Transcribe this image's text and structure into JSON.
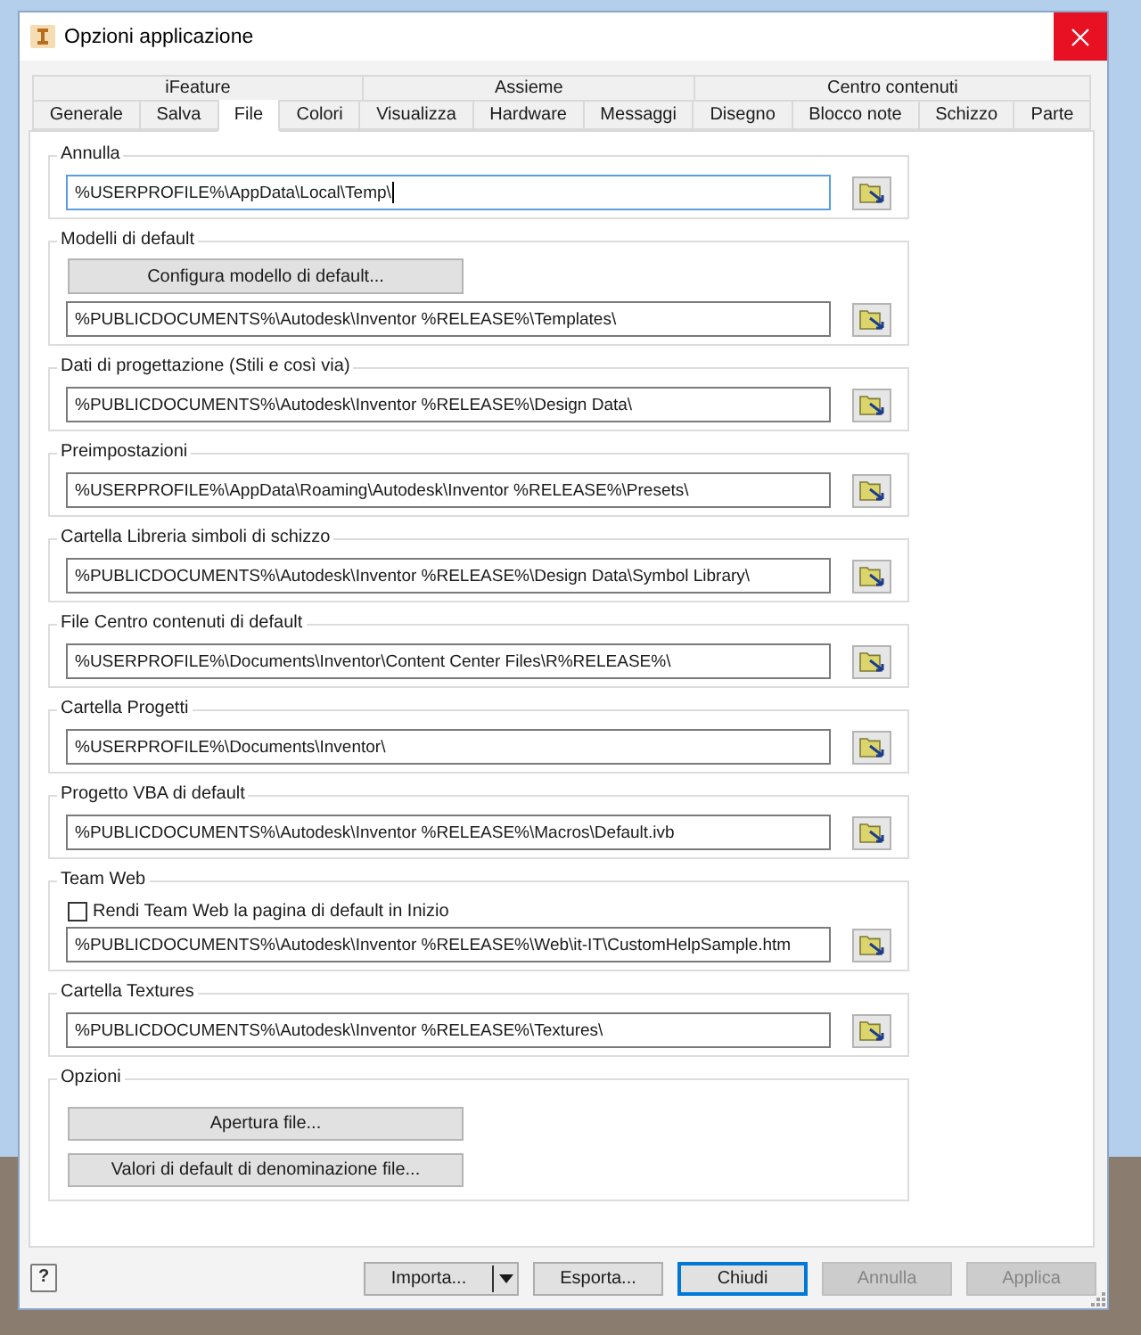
{
  "window": {
    "title": "Opzioni applicazione"
  },
  "tab_rows": [
    [
      {
        "label": "iFeature",
        "selected": false
      },
      {
        "label": "Assieme",
        "selected": false
      },
      {
        "label": "Centro contenuti",
        "selected": false
      }
    ],
    [
      {
        "label": "Generale",
        "selected": false
      },
      {
        "label": "Salva",
        "selected": false
      },
      {
        "label": "File",
        "selected": true
      },
      {
        "label": "Colori",
        "selected": false
      },
      {
        "label": "Visualizza",
        "selected": false
      },
      {
        "label": "Hardware",
        "selected": false
      },
      {
        "label": "Messaggi",
        "selected": false
      },
      {
        "label": "Disegno",
        "selected": false
      },
      {
        "label": "Blocco note",
        "selected": false
      },
      {
        "label": "Schizzo",
        "selected": false
      },
      {
        "label": "Parte",
        "selected": false
      }
    ]
  ],
  "sections": [
    {
      "legend": "Annulla",
      "items": [
        {
          "kind": "path",
          "value": "%USERPROFILE%\\AppData\\Local\\Temp\\",
          "focused": true
        }
      ]
    },
    {
      "legend": "Modelli di default",
      "items": [
        {
          "kind": "button",
          "label": "Configura modello di default..."
        },
        {
          "kind": "path",
          "value": "%PUBLICDOCUMENTS%\\Autodesk\\Inventor %RELEASE%\\Templates\\",
          "focused": false
        }
      ]
    },
    {
      "legend": "Dati di progettazione (Stili e così via)",
      "items": [
        {
          "kind": "path",
          "value": "%PUBLICDOCUMENTS%\\Autodesk\\Inventor %RELEASE%\\Design Data\\",
          "focused": false
        }
      ]
    },
    {
      "legend": "Preimpostazioni",
      "items": [
        {
          "kind": "path",
          "value": "%USERPROFILE%\\AppData\\Roaming\\Autodesk\\Inventor %RELEASE%\\Presets\\",
          "focused": false
        }
      ]
    },
    {
      "legend": "Cartella Libreria simboli di schizzo",
      "items": [
        {
          "kind": "path",
          "value": "%PUBLICDOCUMENTS%\\Autodesk\\Inventor %RELEASE%\\Design Data\\Symbol Library\\",
          "focused": false
        }
      ]
    },
    {
      "legend": "File Centro contenuti di default",
      "items": [
        {
          "kind": "path",
          "value": "%USERPROFILE%\\Documents\\Inventor\\Content Center Files\\R%RELEASE%\\",
          "focused": false
        }
      ]
    },
    {
      "legend": "Cartella Progetti",
      "items": [
        {
          "kind": "path",
          "value": "%USERPROFILE%\\Documents\\Inventor\\",
          "focused": false
        }
      ]
    },
    {
      "legend": "Progetto VBA di default",
      "items": [
        {
          "kind": "path",
          "value": "%PUBLICDOCUMENTS%\\Autodesk\\Inventor %RELEASE%\\Macros\\Default.ivb",
          "focused": false
        }
      ]
    },
    {
      "legend": "Team Web",
      "items": [
        {
          "kind": "checkbox",
          "label": "Rendi Team Web la pagina di default in Inizio",
          "checked": false
        },
        {
          "kind": "path",
          "value": "%PUBLICDOCUMENTS%\\Autodesk\\Inventor %RELEASE%\\Web\\it-IT\\CustomHelpSample.htm",
          "focused": false
        }
      ]
    },
    {
      "legend": "Cartella Textures",
      "items": [
        {
          "kind": "path",
          "value": "%PUBLICDOCUMENTS%\\Autodesk\\Inventor %RELEASE%\\Textures\\",
          "focused": false
        }
      ]
    },
    {
      "legend": "Opzioni",
      "items": [
        {
          "kind": "button",
          "label": "Apertura file..."
        },
        {
          "kind": "button",
          "label": "Valori di default di denominazione file..."
        }
      ]
    }
  ],
  "footer": {
    "help_label": "?",
    "buttons": [
      {
        "label": "Importa...",
        "kind": "split",
        "default": false,
        "disabled": false
      },
      {
        "label": "Esporta...",
        "kind": "plain",
        "default": false,
        "disabled": false
      },
      {
        "label": "Chiudi",
        "kind": "plain",
        "default": true,
        "disabled": false
      },
      {
        "label": "Annulla",
        "kind": "plain",
        "default": false,
        "disabled": true
      },
      {
        "label": "Applica",
        "kind": "plain",
        "default": false,
        "disabled": true
      }
    ]
  }
}
